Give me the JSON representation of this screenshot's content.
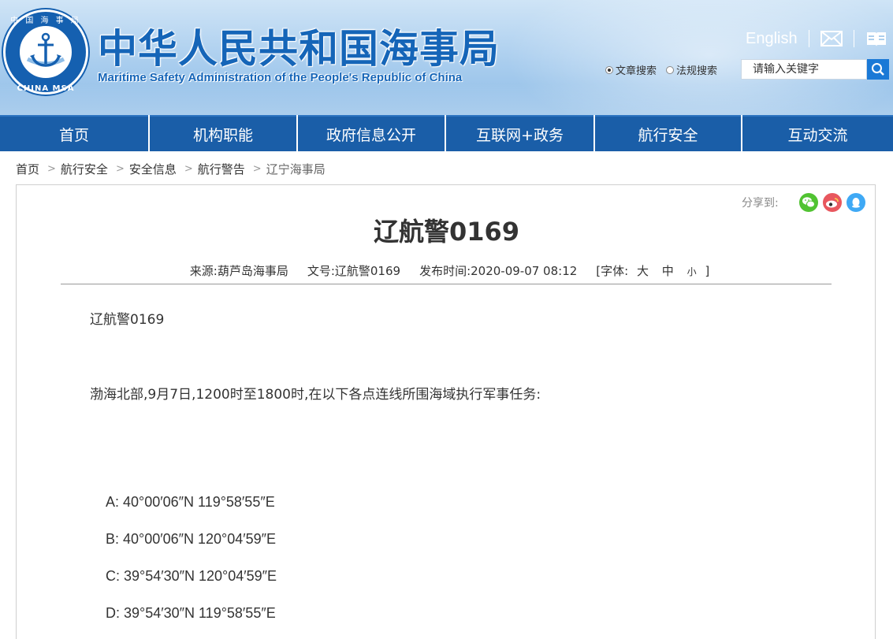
{
  "header": {
    "logo": {
      "top_text": "中 国 海 事 局",
      "bottom_text": "CHINA MSA",
      "icon": "anchor-icon"
    },
    "title": "中华人民共和国海事局",
    "subtitle": "Maritime Safety Administration of the People's Republic of China",
    "english_link": "English",
    "mail_icon": "mail-icon",
    "book_icon": "book-icon",
    "search": {
      "option_article": "文章搜索",
      "option_law": "法规搜索",
      "selected": "文章搜索",
      "placeholder": "请输入关键字",
      "button_icon": "search-icon"
    }
  },
  "nav": {
    "items": [
      {
        "label": "首页"
      },
      {
        "label": "机构职能"
      },
      {
        "label": "政府信息公开"
      },
      {
        "label": "互联网+政务"
      },
      {
        "label": "航行安全"
      },
      {
        "label": "互动交流"
      }
    ]
  },
  "breadcrumb": [
    "首页",
    "航行安全",
    "安全信息",
    "航行警告",
    "辽宁海事局"
  ],
  "article": {
    "share_label": "分享到:",
    "share_icons": [
      "wechat-icon",
      "weibo-icon",
      "qq-icon"
    ],
    "title": "辽航警0169",
    "meta": {
      "source": "来源:葫芦岛海事局",
      "doc_no": "文号:辽航警0169",
      "published": "发布时间:2020-09-07 08:12",
      "font_label": "[字体:",
      "font_large": "大",
      "font_medium": "中",
      "font_small": "小",
      "font_close": "]"
    },
    "body": {
      "heading": "辽航警0169",
      "intro": "渤海北部,9月7日,1200时至1800时,在以下各点连线所围海域执行军事任务:",
      "points": [
        "A: 40°00′06″N 119°58′55″E",
        "B: 40°00′06″N 120°04′59″E",
        "C: 39°54′30″N 120°04′59″E",
        "D: 39°54′30″N 119°58′55″E"
      ]
    }
  },
  "colors": {
    "brand_blue": "#1565b8",
    "nav_blue": "#1a5ea8",
    "search_button": "#1a79d6",
    "wechat": "#51c332",
    "weibo": "#e6162d",
    "qq": "#3fa9f5"
  }
}
